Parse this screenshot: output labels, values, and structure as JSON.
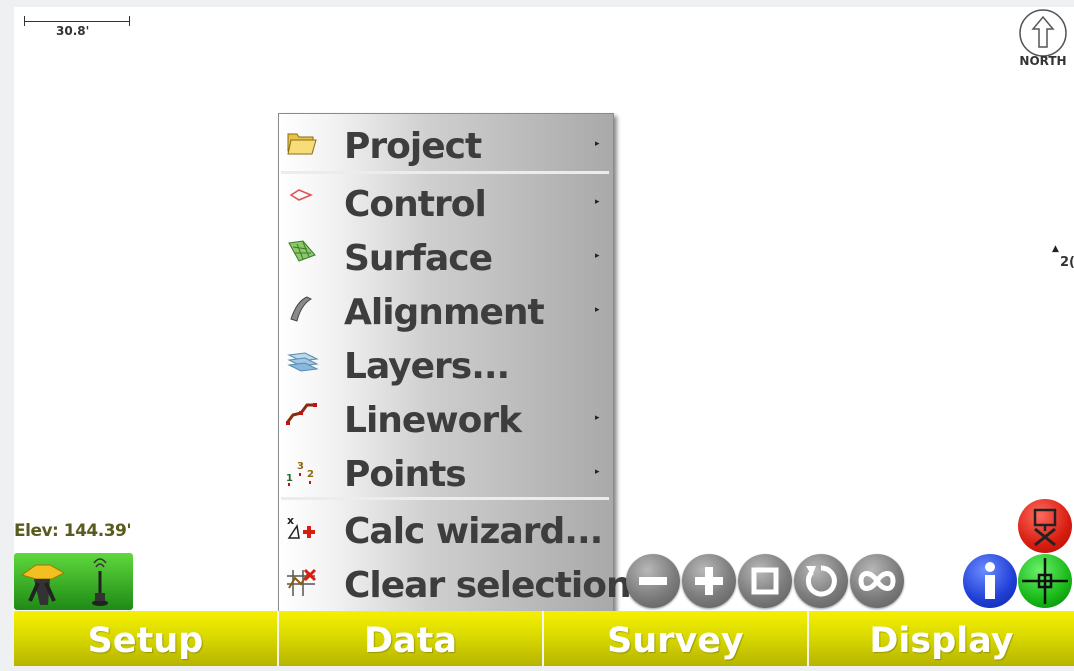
{
  "scale_bar": {
    "label": "30.8'"
  },
  "north_indicator": {
    "label": "NORTH"
  },
  "map_point": {
    "label": "2("
  },
  "elevation": {
    "text": "Elev: 144.39'"
  },
  "data_menu": {
    "items": [
      {
        "label": "Project",
        "icon": "folder-icon",
        "has_submenu": true
      },
      {
        "label": "Control",
        "icon": "control-icon",
        "has_submenu": true
      },
      {
        "label": "Surface",
        "icon": "surface-icon",
        "has_submenu": true
      },
      {
        "label": "Alignment",
        "icon": "alignment-icon",
        "has_submenu": true
      },
      {
        "label": "Layers...",
        "icon": "layers-icon",
        "has_submenu": false
      },
      {
        "label": "Linework",
        "icon": "linework-icon",
        "has_submenu": true
      },
      {
        "label": "Points",
        "icon": "points-icon",
        "has_submenu": true
      },
      {
        "label": "Calc wizard...",
        "icon": "calc-wizard-icon",
        "has_submenu": false
      },
      {
        "label": "Clear selection",
        "icon": "clear-selection-icon",
        "has_submenu": false
      }
    ],
    "submenu_arrow": "▸"
  },
  "map_controls": [
    "zoom-out-icon",
    "zoom-in-icon",
    "zoom-extents-icon",
    "rotate-icon",
    "infinity-icon",
    "info-icon",
    "crosshair-icon",
    "survey-off-icon"
  ],
  "tabs": [
    {
      "label": "Setup"
    },
    {
      "label": "Data"
    },
    {
      "label": "Survey"
    },
    {
      "label": "Display"
    }
  ],
  "colors": {
    "tab_yellow": "#dada00",
    "menu_text": "#3d3d3d",
    "instrument_green": "#3cb52a",
    "elev_text": "#5a5a1e"
  }
}
